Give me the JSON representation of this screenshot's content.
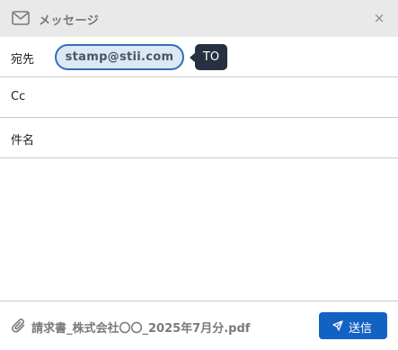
{
  "window": {
    "title": "メッセージ",
    "icon": "mail-icon",
    "close_symbol": "×"
  },
  "fields": {
    "to": {
      "label": "宛先",
      "recipients": [
        "stamp@stii.com"
      ],
      "tooltip": "TO"
    },
    "cc": {
      "label": "Cc",
      "value": ""
    },
    "subject": {
      "label": "件名",
      "value": ""
    }
  },
  "body": {
    "value": ""
  },
  "footer": {
    "attachment_name": "請求書_株式会社〇〇_2025年7月分.pdf",
    "attachment_icon": "paperclip-icon",
    "send_label": "送信",
    "send_icon": "send-icon"
  },
  "colors": {
    "titlebar_bg": "#e9e9e9",
    "chip_border": "#2f6fb7",
    "chip_bg": "#dce8f3",
    "tooltip_bg": "#263040",
    "send_button_bg": "#1262c4"
  }
}
